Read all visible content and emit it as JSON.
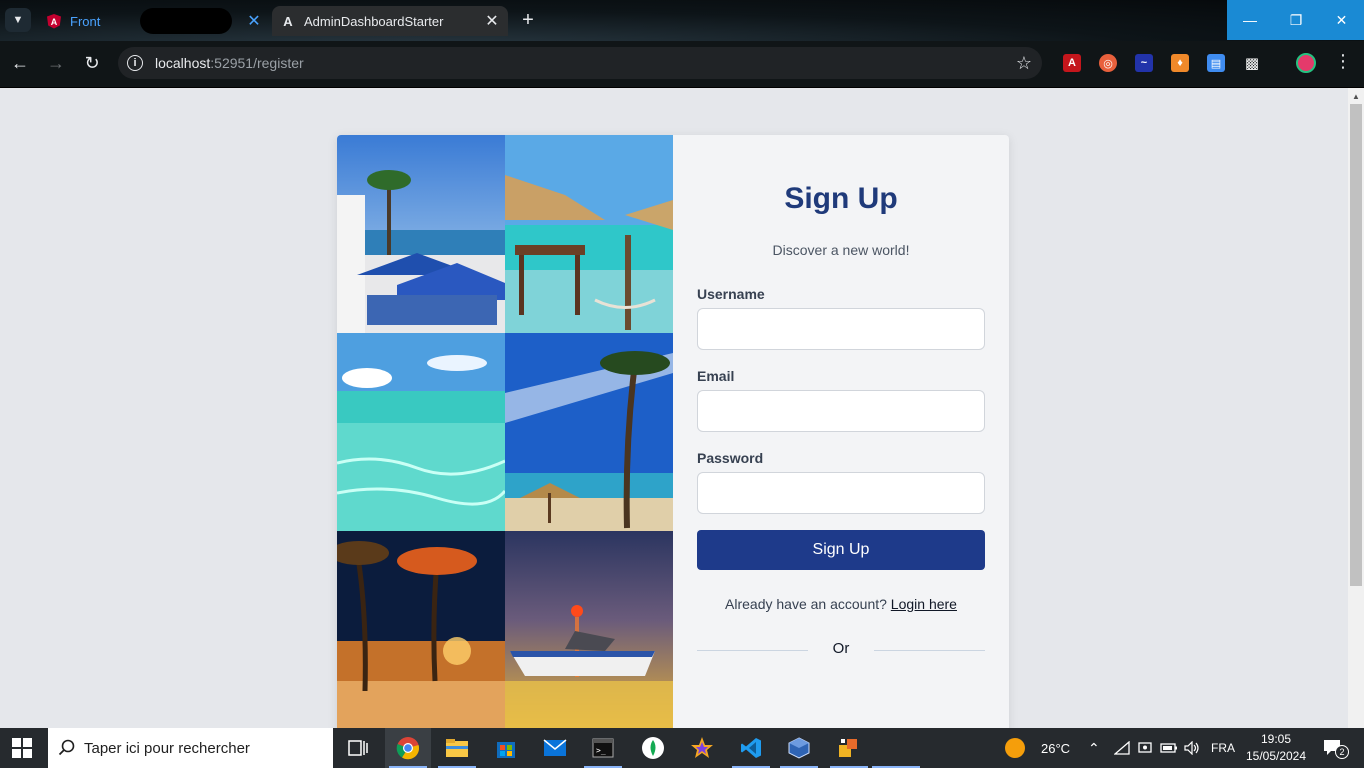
{
  "browser": {
    "tabs": [
      {
        "title": "Front",
        "active": false
      },
      {
        "title": "AdminDashboardStarter",
        "active": true
      }
    ],
    "url_host": "localhost",
    "url_rest": ":52951/register"
  },
  "signup": {
    "title": "Sign Up",
    "subtitle": "Discover a new world!",
    "fields": [
      {
        "label": "Username",
        "value": "",
        "placeholder": ""
      },
      {
        "label": "Email",
        "value": "",
        "placeholder": ""
      },
      {
        "label": "Password",
        "value": "",
        "placeholder": ""
      }
    ],
    "submit_label": "Sign Up",
    "login_prompt": "Already have an account?",
    "login_link": "Login here",
    "divider_text": "Or"
  },
  "gallery": {
    "photos": [
      "harbor-cafe-photo",
      "beach-huts-photo",
      "clear-water-photo",
      "palm-beach-photo",
      "night-palms-photo",
      "sunset-boat-photo"
    ]
  },
  "taskbar": {
    "search_placeholder": "Taper ici pour rechercher",
    "weather_temp": "26°C",
    "language": "FRA",
    "time": "19:05",
    "date": "15/05/2024",
    "notification_count": "2"
  },
  "colors": {
    "primary": "#1e3a8a",
    "title": "#1f3a7a",
    "page_bg": "#e5e7eb",
    "card_bg": "#f3f4f6"
  }
}
